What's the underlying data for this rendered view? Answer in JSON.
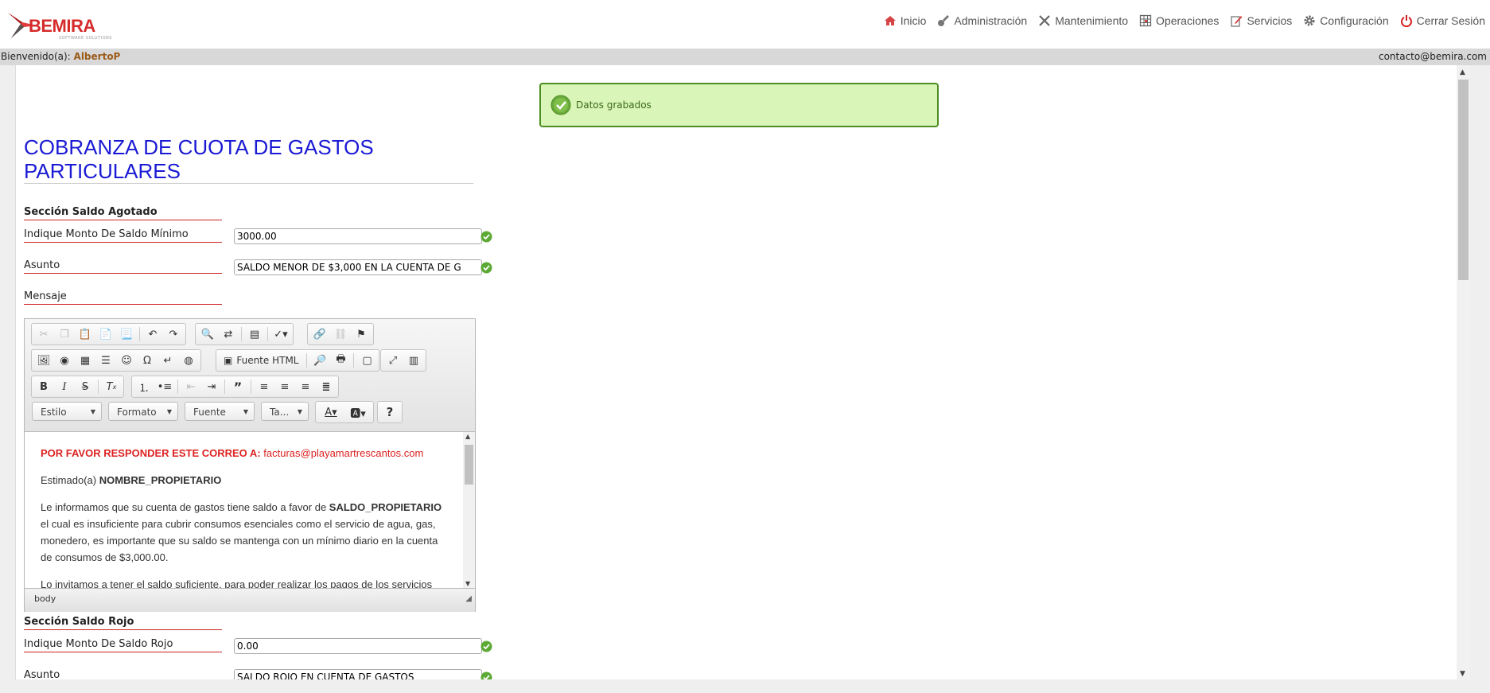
{
  "brand": {
    "name": "BEMIRA",
    "tagline": "SOFTWARE SOLUTIONS"
  },
  "nav": [
    {
      "label": "Inicio",
      "icon": "home-icon"
    },
    {
      "label": "Administración",
      "icon": "guitar-icon"
    },
    {
      "label": "Mantenimiento",
      "icon": "tools-icon"
    },
    {
      "label": "Operaciones",
      "icon": "grid-icon"
    },
    {
      "label": "Servicios",
      "icon": "edit-icon"
    },
    {
      "label": "Configuración",
      "icon": "gear-icon"
    },
    {
      "label": "Cerrar Sesión",
      "icon": "power-icon"
    }
  ],
  "welcome": {
    "prefix": "Bienvenido(a):",
    "user": "AlbertoP",
    "email": "contacto@bemira.com"
  },
  "notice": {
    "text": "Datos grabados"
  },
  "page": {
    "title": "COBRANZA DE CUOTA DE GASTOS PARTICULARES"
  },
  "section1": {
    "title": "Sección Saldo Agotado",
    "min_label": "Indique Monto De Saldo Mínimo",
    "min_value": "3000.00",
    "subject_label": "Asunto",
    "subject_value": "SALDO MENOR DE $3,000 EN LA CUENTA DE G",
    "message_label": "Mensaje"
  },
  "editor": {
    "toolbar": {
      "html_source": "Fuente HTML",
      "style": "Estilo",
      "format": "Formato",
      "font": "Fuente",
      "size": "Ta...",
      "help": "?"
    },
    "content": {
      "respond_prefix": "POR FAVOR RESPONDER ESTE CORREO A:",
      "respond_email": "facturas@playamartrescantos.com",
      "greeting": "Estimado(a)",
      "owner_name": "NOMBRE_PROPIETARIO",
      "para1_a": "Le informamos que su cuenta de gastos tiene saldo a favor de",
      "para1_balance": "SALDO_PROPIETARIO",
      "para1_b": "el cual es insuficiente para cubrir consumos esenciales como el servicio de agua, gas, monedero, es importante que su saldo se mantenga con un mínimo diario en la cuenta de consumos de $3,000.00.",
      "para2": "Lo invitamos a tener el saldo suficiente, para poder realizar los pagos de los servicios"
    },
    "path": "body"
  },
  "section2": {
    "title": "Sección Saldo Rojo",
    "red_label": "Indique Monto De Saldo Rojo",
    "red_value": "0.00",
    "subject_label": "Asunto",
    "subject_value": "SALDO ROJO EN CUENTA DE GASTOS"
  }
}
